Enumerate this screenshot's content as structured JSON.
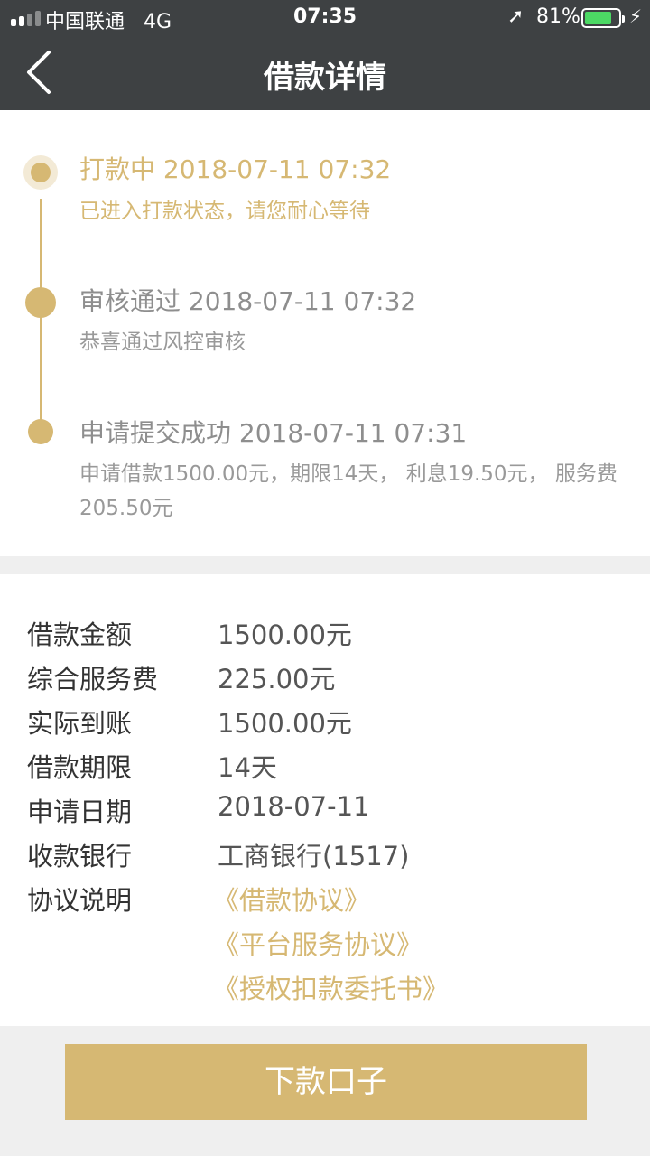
{
  "status_bar": {
    "carrier": "中国联通",
    "network": "4G",
    "time": "07:35",
    "battery_percent": "81%",
    "battery_level": 0.81,
    "battery_color": "#4cd964",
    "location_icon": "location-arrow-icon",
    "charging_icon": "bolt-icon"
  },
  "nav": {
    "title": "借款详情",
    "back_icon": "chevron-left-icon"
  },
  "timeline": {
    "accent_color": "#d6b873",
    "steps": [
      {
        "title": "打款中 2018-07-11 07:32",
        "desc": "已进入打款状态，请您耐心等待",
        "active": true
      },
      {
        "title": "审核通过 2018-07-11 07:32",
        "desc": "恭喜通过风控审核",
        "active": false
      },
      {
        "title": "申请提交成功 2018-07-11 07:31",
        "desc": "申请借款1500.00元，期限14天， 利息19.50元， 服务费205.50元",
        "active": false
      }
    ]
  },
  "details": {
    "rows": [
      {
        "label": "借款金额",
        "value": "1500.00元"
      },
      {
        "label": "综合服务费",
        "value": "225.00元"
      },
      {
        "label": "实际到账",
        "value": "1500.00元"
      },
      {
        "label": "借款期限",
        "value": "14天"
      },
      {
        "label": "申请日期",
        "value": "2018-07-11"
      },
      {
        "label": "收款银行",
        "value": "工商银行(1517)"
      }
    ],
    "agreements_label": "协议说明",
    "agreements": [
      "《借款协议》",
      "《平台服务协议》",
      "《授权扣款委托书》"
    ]
  },
  "cta": {
    "label": "下款口子",
    "color": "#d6b873"
  }
}
